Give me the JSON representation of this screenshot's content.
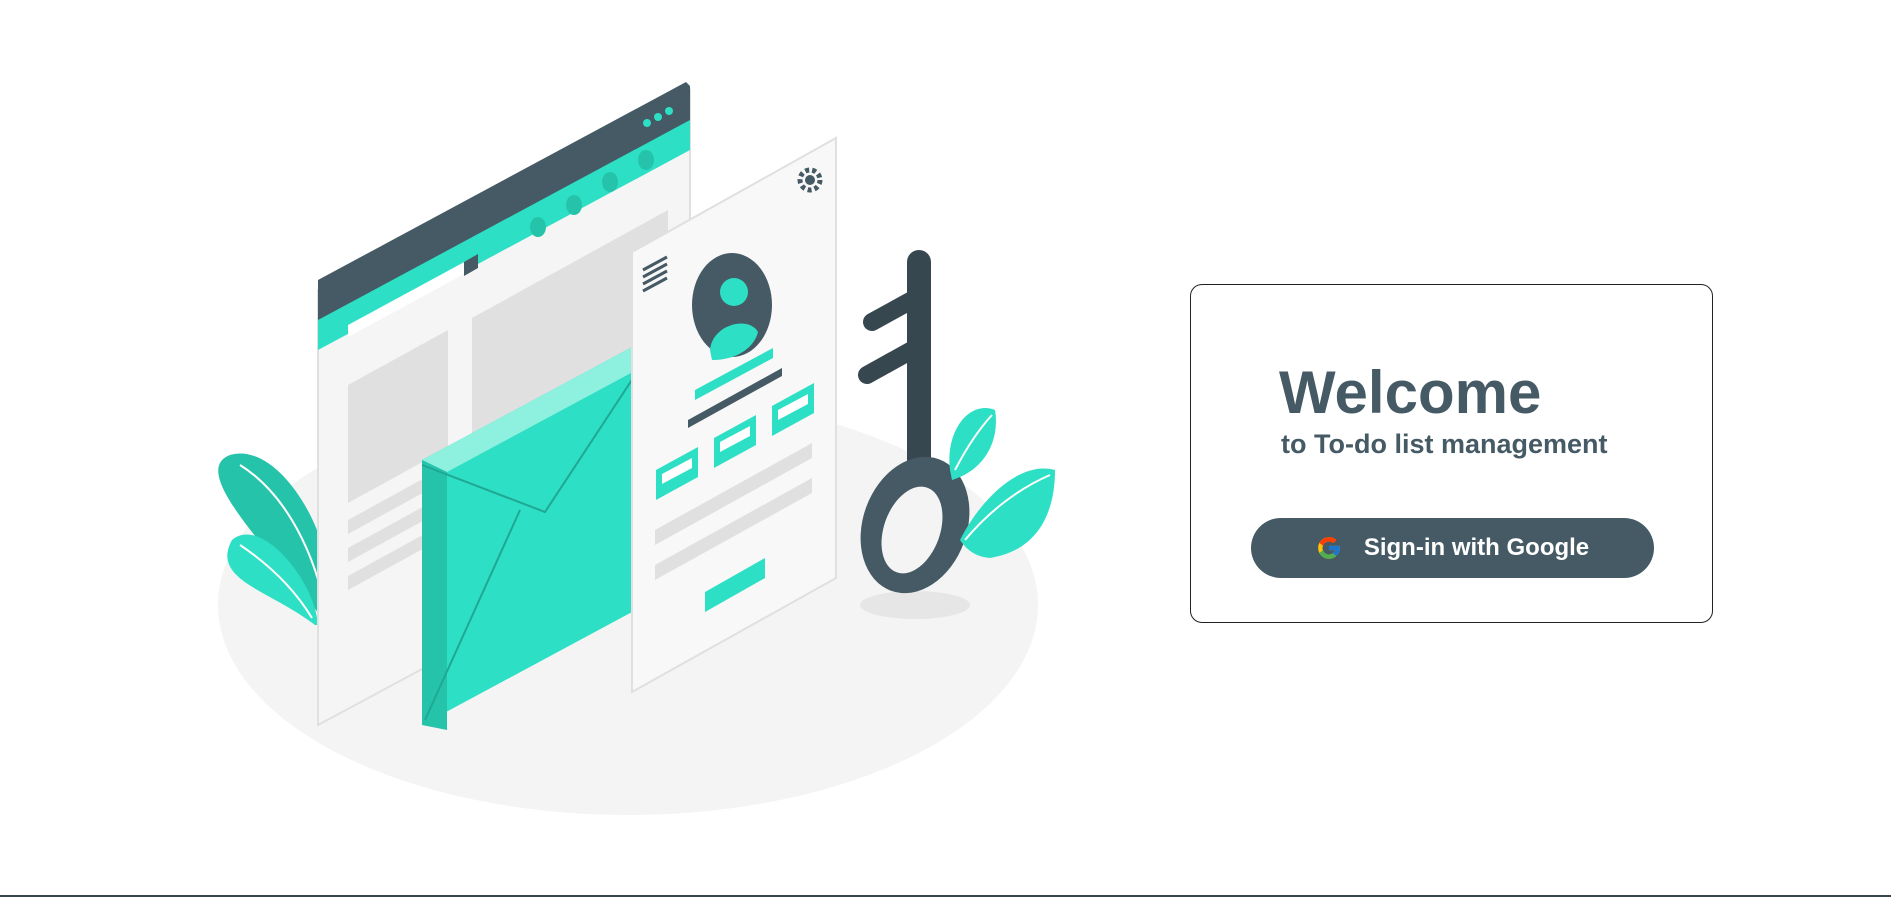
{
  "illustration": {
    "name": "login-security-illustration",
    "icons": [
      "browser-window",
      "envelope-icon",
      "profile-form",
      "key-icon",
      "gear-icon",
      "hamburger-menu-icon",
      "leaf-plant"
    ]
  },
  "login_card": {
    "title": "Welcome",
    "subtitle": "to To-do list management",
    "google_button": {
      "label": "Sign-in with Google",
      "icon": "google-icon"
    }
  },
  "colors": {
    "accent": "#2ddfc4",
    "accent_dark": "#25c4aa",
    "slate": "#455a64",
    "slate_dark": "#37474f",
    "panel": "#f5f5f5",
    "placeholder": "#e0e0e0"
  }
}
